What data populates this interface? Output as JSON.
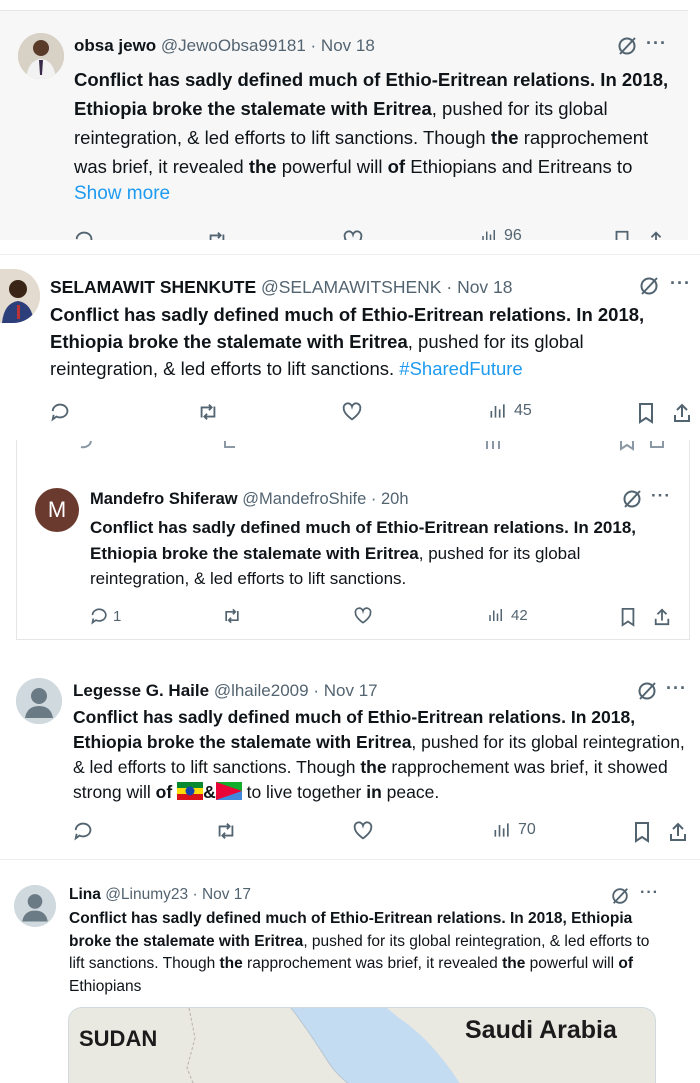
{
  "tweets": [
    {
      "name": "obsa jewo",
      "handle": "@JewoObsa99181",
      "sep": "·",
      "date": "Nov 18",
      "bold1": "Conflict has sadly defined much of Ethio-Eritrean relations. In 2018, Ethiopia broke the stalemate with Eritrea",
      "plain1": ", pushed for its global reintegration, & led efforts to lift sanctions. Though ",
      "bold2": "the",
      "plain2": " rapprochement was brief, it revealed ",
      "bold3": "the",
      "plain3": " powerful will ",
      "bold4": "of",
      "plain4": " Ethiopians and Eritreans to",
      "show_more": "Show more",
      "views_partial": "96"
    },
    {
      "name": "SELAMAWIT SHENKUTE",
      "handle": "@SELAMAWITSHENK",
      "sep": "·",
      "date": "Nov 18",
      "bold1": "Conflict has sadly defined much of Ethio-Eritrean relations. In 2018, Ethiopia broke the stalemate with Eritrea",
      "plain1": ", pushed for its global reintegration, & led efforts to lift sanctions. ",
      "hashtag": "#SharedFuture",
      "views": "45"
    },
    {
      "avatar_letter": "M",
      "name": "Mandefro Shiferaw",
      "handle": "@MandefroShife",
      "sep": "·",
      "date": "20h",
      "bold1": "Conflict has sadly defined much of Ethio-Eritrean relations. In 2018, Ethiopia broke the stalemate with Eritrea",
      "plain1": ", pushed for its global reintegration, & led efforts to lift sanctions.",
      "replies": "1",
      "views": "42"
    },
    {
      "name": "Legesse G. Haile",
      "handle": "@lhaile2009",
      "sep": "·",
      "date": "Nov 17",
      "bold1": "Conflict has sadly defined much of Ethio-Eritrean relations. In 2018, Ethiopia broke the stalemate with Eritrea",
      "plain1": ", pushed for its global reintegration, & led efforts to lift sanctions. Though ",
      "bold2": "the",
      "plain2": " rapprochement was brief, it showed strong will ",
      "bold3": "of",
      "amp": "&",
      "plain3": " to live together ",
      "bold4": "in",
      "plain4": " peace.",
      "views": "70"
    },
    {
      "name": "Lina",
      "handle": "@Linumy23",
      "sep": "·",
      "date": "Nov 17",
      "bold1": "Conflict has sadly defined much of Ethio-Eritrean relations. In 2018, Ethiopia broke the stalemate with Eritrea",
      "plain1": ", pushed for its global reintegration, & led efforts to lift sanctions. Though ",
      "bold2": "the",
      "plain2": " rapprochement was brief, it revealed ",
      "bold3": "the",
      "plain3": " powerful will ",
      "bold4": "of",
      "plain4": " Ethiopians"
    }
  ],
  "map": {
    "label_left": "SUDAN",
    "label_right": "Saudi Arabia"
  },
  "colors": {
    "link": "#1d9bf0",
    "muted": "#536471",
    "text": "#0f1419",
    "sea": "#c3dcf1",
    "land": "#e9e8e1"
  }
}
